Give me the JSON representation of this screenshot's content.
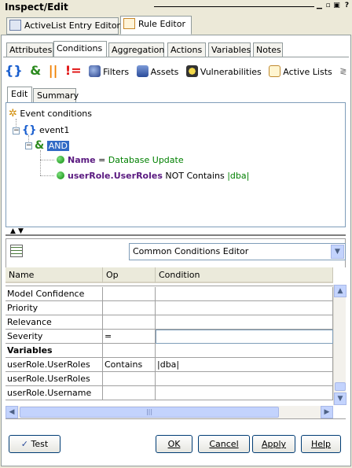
{
  "window": {
    "title": "Inspect/Edit",
    "controls": [
      "minimize",
      "maximize",
      "close",
      "help"
    ]
  },
  "editor_tabs": [
    {
      "label": "ActiveList Entry Editor",
      "icon": "activelist-icon",
      "selected": false
    },
    {
      "label": "Rule Editor",
      "icon": "rule-icon",
      "selected": true
    }
  ],
  "section_tabs": [
    {
      "label": "Attributes",
      "selected": false
    },
    {
      "label": "Conditions",
      "selected": true
    },
    {
      "label": "Aggregation",
      "selected": false
    },
    {
      "label": "Actions",
      "selected": false
    },
    {
      "label": "Variables",
      "selected": false
    },
    {
      "label": "Notes",
      "selected": false
    }
  ],
  "toolbar": {
    "braces": "{}",
    "and": "&",
    "or": "||",
    "not_equal": "!=",
    "filters": "Filters",
    "assets": "Assets",
    "vulnerabilities": "Vulnerabilities",
    "active_lists": "Active Lists"
  },
  "view_tabs": [
    {
      "label": "Edit",
      "selected": true
    },
    {
      "label": "Summary",
      "selected": false
    }
  ],
  "tree": {
    "root": "Event conditions",
    "event": "event1",
    "operator": "AND",
    "conditions": [
      {
        "field": "Name",
        "op": "=",
        "value": "Database Update"
      },
      {
        "field": "userRole.UserRoles",
        "op": "NOT Contains",
        "value": "|dba|"
      }
    ]
  },
  "condition_editor": {
    "selected": "Common Conditions Editor"
  },
  "grid": {
    "columns": [
      "Name",
      "Op",
      "Condition"
    ],
    "rows": [
      {
        "name": "Model Confidence",
        "op": "",
        "cond": "",
        "bold": false
      },
      {
        "name": "Priority",
        "op": "",
        "cond": "",
        "bold": false
      },
      {
        "name": "Relevance",
        "op": "",
        "cond": "",
        "bold": false
      },
      {
        "name": "Severity",
        "op": "=",
        "cond": "",
        "bold": false
      },
      {
        "name": "Variables",
        "op": "",
        "cond": "",
        "bold": true
      },
      {
        "name": "userRole.UserRoles",
        "op": "Contains",
        "cond": "|dba|",
        "bold": false
      },
      {
        "name": "userRole.UserRoles",
        "op": "",
        "cond": "",
        "bold": false
      },
      {
        "name": "userRole.Username",
        "op": "",
        "cond": "",
        "bold": false
      }
    ]
  },
  "buttons": {
    "test": "Test",
    "ok": "OK",
    "cancel": "Cancel",
    "apply": "Apply",
    "help": "Help"
  },
  "colors": {
    "accent_selection": "#316ac5",
    "field_purple": "#5a1a80",
    "value_green": "#008000",
    "node_green": "#1e8a1e",
    "tab_border": "#919b9c"
  }
}
